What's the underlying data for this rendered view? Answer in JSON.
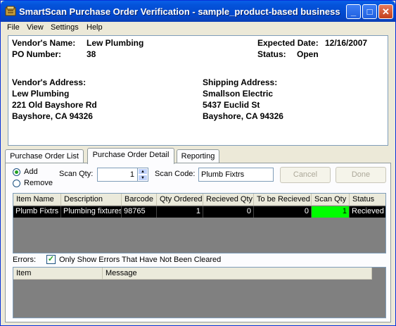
{
  "window": {
    "title": "SmartScan Purchase Order Verification - sample_product-based business",
    "minimize": "_",
    "maximize": "□",
    "close": "✕"
  },
  "menu": [
    "File",
    "View",
    "Settings",
    "Help"
  ],
  "header": {
    "vendor_name_label": "Vendor's Name:",
    "vendor_name": "Lew Plumbing",
    "po_number_label": "PO Number:",
    "po_number": "38",
    "expected_date_label": "Expected Date:",
    "expected_date": "12/16/2007",
    "status_label": "Status:",
    "status": "Open",
    "vendor_address_label": "Vendor's Address:",
    "vendor_address": [
      "Lew Plumbing",
      "221 Old Bayshore Rd",
      "Bayshore, CA 94326"
    ],
    "shipping_address_label": "Shipping Address:",
    "shipping_address": [
      "Smallson Electric",
      "5437 Euclid St",
      "Bayshore, CA 94326"
    ]
  },
  "tabs": [
    "Purchase Order List",
    "Purchase Order Detail",
    "Reporting"
  ],
  "active_tab": "Purchase Order Detail",
  "detail": {
    "add_label": "Add",
    "remove_label": "Remove",
    "selected_mode": "Add",
    "scan_qty_label": "Scan Qty:",
    "scan_qty": "1",
    "scan_code_label": "Scan Code:",
    "scan_code": "Plumb Fixtrs",
    "cancel_label": "Cancel",
    "done_label": "Done",
    "items_columns": [
      "Item Name",
      "Description",
      "Barcode",
      "Qty Ordered",
      "Recieved Qty",
      "To be Recieved",
      "Scan Qty",
      "Status"
    ],
    "items_rows": [
      [
        "Plumb Fixtrs",
        "Plumbing fixtures",
        "98765",
        "1",
        "0",
        "0",
        "1",
        "Recieved"
      ]
    ],
    "scan_highlight_color": "#00ff00",
    "errors_label": "Errors:",
    "errors_filter_label": "Only Show Errors That Have Not Been Cleared",
    "errors_filter_checked": true,
    "errors_columns": [
      "Item",
      "Message"
    ]
  }
}
